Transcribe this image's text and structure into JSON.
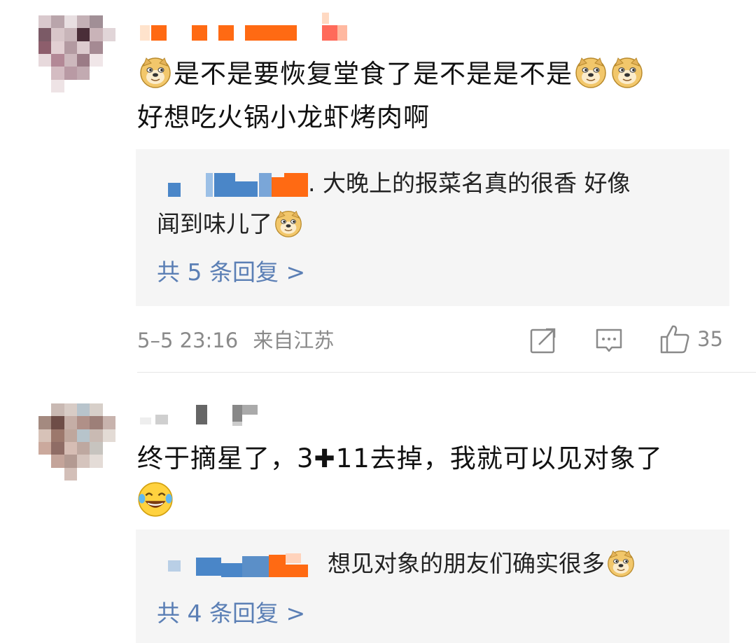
{
  "comments": [
    {
      "text_line1": "是不是要恢复堂食了是不是是不是",
      "text_line2": "好想吃火锅小龙虾烤肉啊",
      "emoji_icon": "doge-icon",
      "reply": {
        "prefix": ".",
        "text": " 大晚上的报菜名真的很香 好像",
        "text_line2": "闻到味儿了",
        "more": "共 5 条回复 >"
      },
      "time": "5–5 23:16",
      "location": "来自江苏",
      "likes": "35"
    },
    {
      "text_line1": "终于摘星了，3",
      "text_plus": "✚",
      "text_line1b": "11去掉，我就可以见对象了",
      "emoji_icon": "laugh-cry-icon",
      "reply": {
        "text": "想见对象的朋友们确实很多",
        "more": "共 4 条回复 >"
      }
    }
  ],
  "colors": {
    "link": "#5b7fb5",
    "meta": "#8a8a8a",
    "reply_bg": "#f5f5f5",
    "name_orange": "#ff6a13",
    "name_blue": "#4a86c8"
  }
}
